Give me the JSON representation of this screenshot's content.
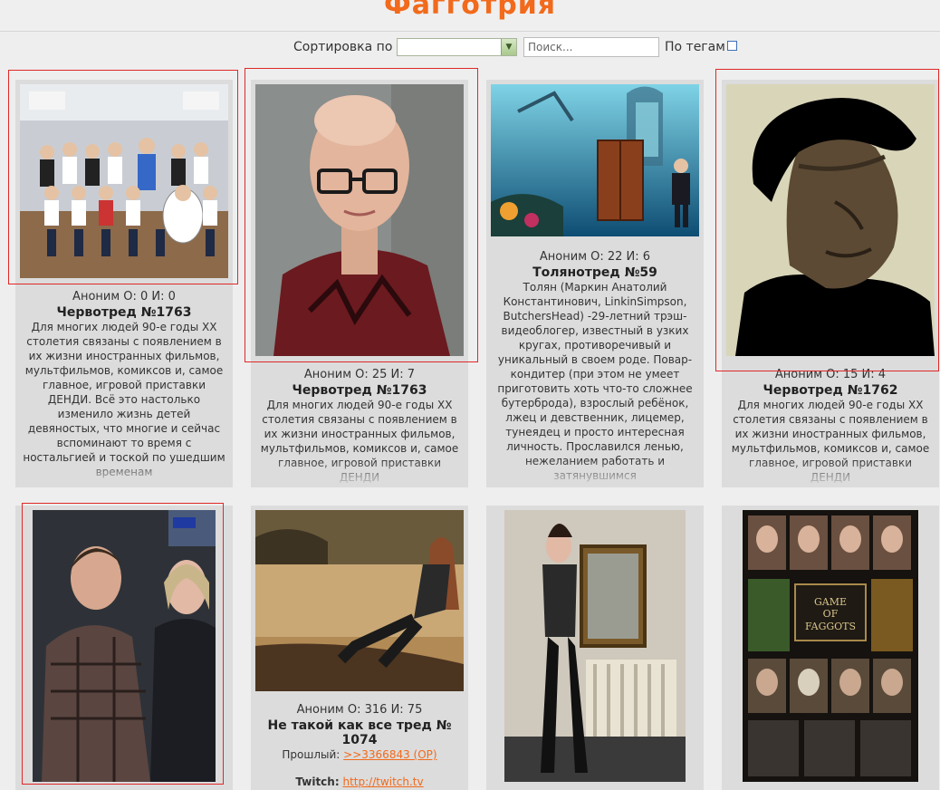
{
  "header": {
    "title": "Фагготрия"
  },
  "controls": {
    "sort_label": "Сортировка по",
    "search_placeholder": "Поиск...",
    "tags_label": "По тегам"
  },
  "cards": [
    {
      "stats": "Аноним  О: 0 И: 0",
      "title": "Червотред №1763",
      "desc": "Для многих людей 90-е годы XX столетия связаны с появлением в их жизни иностранных фильмов, мультфильмов, комиксов и, самое главное, игровой приставки ДЕНДИ. Всё это настолько изменило жизнь детей девяностых, что многие и сейчас вспоминают то время с ностальгией и тоской по ушедшим временам",
      "image": "class-photo"
    },
    {
      "stats": "Аноним  О: 25 И: 7",
      "title": "Червотред №1763",
      "desc": "Для многих людей 90-е годы XX столетия связаны с появлением в их жизни иностранных фильмов, мультфильмов, комиксов и, самое главное, игровой приставки ДЕНДИ",
      "image": "bald-woman-glasses"
    },
    {
      "stats": "Аноним  О: 22 И: 6",
      "title": "Толянотред №59",
      "desc": "Толян (Маркин Анатолий Константинович, LinkinSimpson, ButchersHead) -29-летний трэш-видеоблогер, известный в узких кругах, противоречивый и уникальный в своем роде. Повар-кондитер (при этом не умеет приготовить хоть что-то сложнее бутерброда), взрослый ребёнок, лжец и девственник, лицемер, тунеядец и просто интересная личность. Прославился ленью, нежеланием работать и затянувшимся",
      "image": "underwater-scene"
    },
    {
      "stats": "Аноним  О: 15 И: 4",
      "title": "Червотред №1762",
      "desc": "Для многих людей 90-е годы XX столетия связаны с появлением в их жизни иностранных фильмов, мультфильмов, комиксов и, самое главное, игровой приставки ДЕНДИ",
      "image": "bronze-bust"
    },
    {
      "image": "two-young-men"
    },
    {
      "stats": "Аноним  О: 316 И: 75",
      "title": "Не такой как все тред № 1074",
      "prev_label": "Прошлый:",
      "prev_link": ">>3366843 (OP)",
      "twitch_label": "Twitch:",
      "twitch_link": "http://twitch.tv",
      "image": "girl-by-lake"
    },
    {
      "image": "woman-in-corset"
    },
    {
      "image": "game-of-faggots-poster"
    }
  ],
  "colors": {
    "accent": "#f26a1b",
    "card_bg": "#dcdcdc",
    "highlight": "#e02828"
  }
}
